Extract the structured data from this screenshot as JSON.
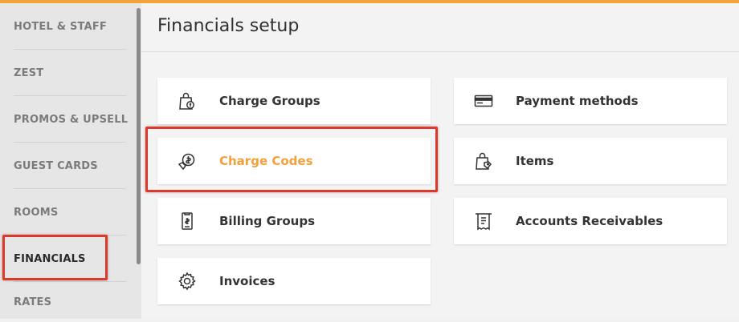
{
  "accent_color": "#f2a33a",
  "highlight_color": "#d93a2b",
  "sidebar": {
    "items": [
      {
        "label": "HOTEL & STAFF"
      },
      {
        "label": "ZEST"
      },
      {
        "label": "PROMOS & UPSELL"
      },
      {
        "label": "GUEST CARDS"
      },
      {
        "label": "ROOMS"
      },
      {
        "label": "FINANCIALS",
        "active": true
      },
      {
        "label": "RATES"
      }
    ]
  },
  "main": {
    "title": "Financials setup",
    "cards": [
      {
        "label": "Charge Groups",
        "icon": "charge-groups-icon"
      },
      {
        "label": "Charge Codes",
        "icon": "charge-codes-icon",
        "active": true
      },
      {
        "label": "Billing Groups",
        "icon": "billing-groups-icon"
      },
      {
        "label": "Invoices",
        "icon": "gear-icon"
      },
      {
        "label": "Payment methods",
        "icon": "credit-card-icon"
      },
      {
        "label": "Items",
        "icon": "items-bag-icon"
      },
      {
        "label": "Accounts Receivables",
        "icon": "receipt-icon"
      }
    ]
  }
}
